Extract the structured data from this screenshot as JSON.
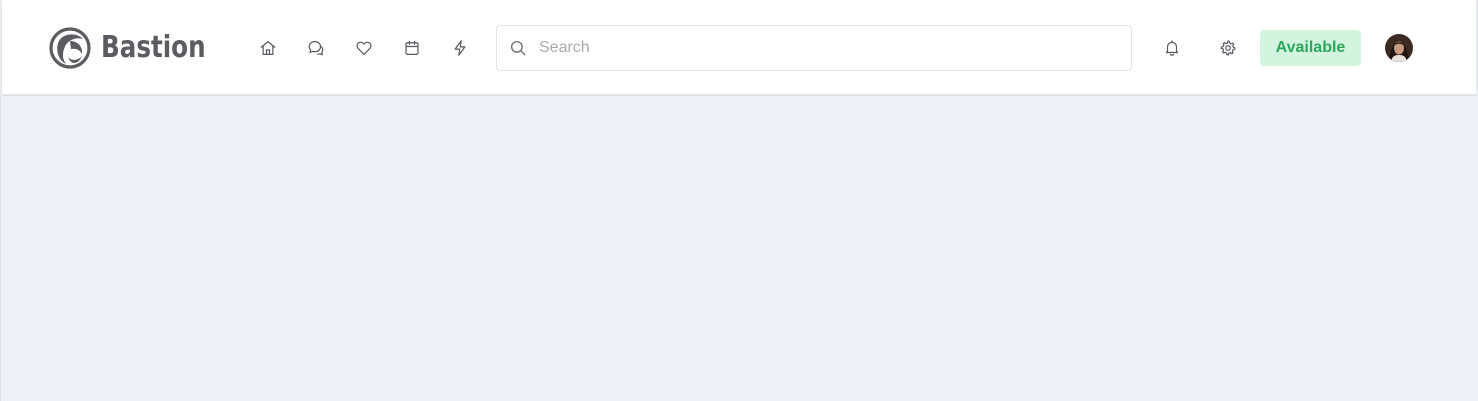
{
  "brand": {
    "name": "Bastion",
    "logo_icon": "bastion-logo-icon"
  },
  "nav": {
    "items": [
      {
        "icon": "home-icon"
      },
      {
        "icon": "chat-icon"
      },
      {
        "icon": "heart-icon"
      },
      {
        "icon": "calendar-icon"
      },
      {
        "icon": "lightning-icon"
      }
    ]
  },
  "search": {
    "placeholder": "Search",
    "value": "",
    "icon": "search-icon"
  },
  "header_right": {
    "notifications_icon": "bell-icon",
    "settings_icon": "gear-icon",
    "status_label": "Available",
    "status_color": "#2aa85a",
    "status_background": "#d3f5df",
    "avatar": "user-avatar"
  },
  "colors": {
    "page_background": "#eef1f6",
    "header_background": "#ffffff",
    "icon_color": "#55585d"
  }
}
